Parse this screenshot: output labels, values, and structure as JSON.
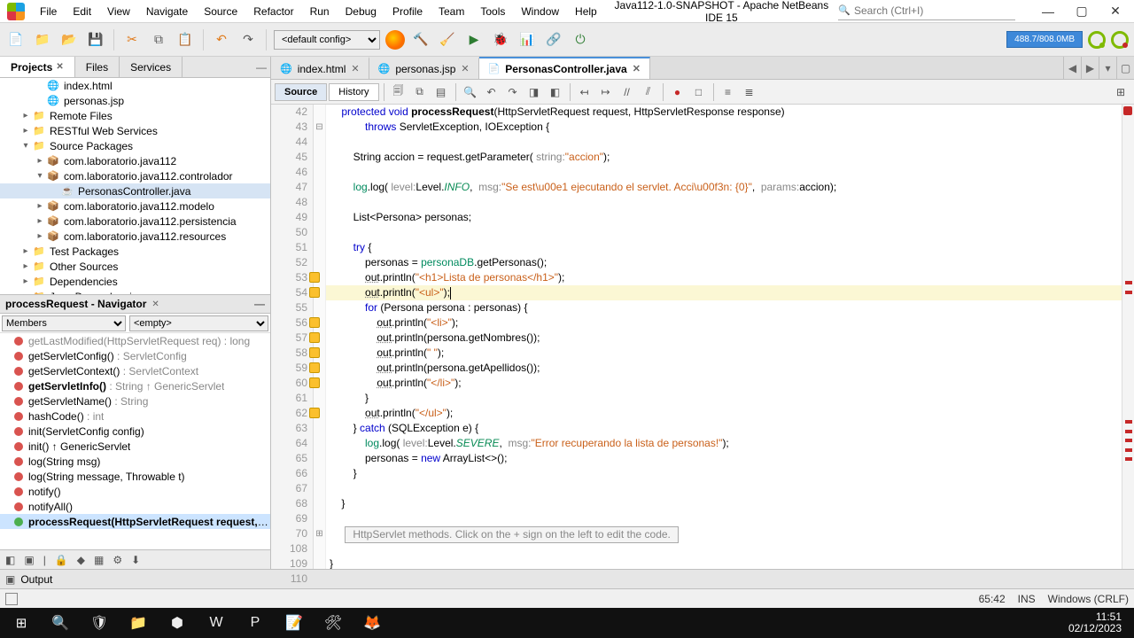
{
  "menubar": {
    "items": [
      "File",
      "Edit",
      "View",
      "Navigate",
      "Source",
      "Refactor",
      "Run",
      "Debug",
      "Profile",
      "Team",
      "Tools",
      "Window",
      "Help"
    ],
    "title": "Java112-1.0-SNAPSHOT - Apache NetBeans IDE 15",
    "search_placeholder": "Search (Ctrl+I)"
  },
  "toolbar": {
    "config": "<default config>",
    "heap": "488.7/808.0MB"
  },
  "projects": {
    "tabs": [
      "Projects",
      "Files",
      "Services"
    ],
    "tree": [
      {
        "indent": 2,
        "icon": "globe",
        "label": "index.html"
      },
      {
        "indent": 2,
        "icon": "globe",
        "label": "personas.jsp"
      },
      {
        "indent": 1,
        "twisty": ">",
        "icon": "folder",
        "label": "Remote Files"
      },
      {
        "indent": 1,
        "twisty": ">",
        "icon": "folder",
        "label": "RESTful Web Services"
      },
      {
        "indent": 1,
        "twisty": "v",
        "icon": "folder",
        "label": "Source Packages"
      },
      {
        "indent": 2,
        "twisty": ">",
        "icon": "pkg",
        "label": "com.laboratorio.java112"
      },
      {
        "indent": 2,
        "twisty": "v",
        "icon": "pkg",
        "label": "com.laboratorio.java112.controlador"
      },
      {
        "indent": 3,
        "icon": "java",
        "label": "PersonasController.java",
        "selected": true
      },
      {
        "indent": 2,
        "twisty": ">",
        "icon": "pkg",
        "label": "com.laboratorio.java112.modelo"
      },
      {
        "indent": 2,
        "twisty": ">",
        "icon": "pkg",
        "label": "com.laboratorio.java112.persistencia"
      },
      {
        "indent": 2,
        "twisty": ">",
        "icon": "pkg",
        "label": "com.laboratorio.java112.resources"
      },
      {
        "indent": 1,
        "twisty": ">",
        "icon": "folder",
        "label": "Test Packages"
      },
      {
        "indent": 1,
        "twisty": ">",
        "icon": "folder",
        "label": "Other Sources"
      },
      {
        "indent": 1,
        "twisty": ">",
        "icon": "folder",
        "label": "Dependencies"
      },
      {
        "indent": 1,
        "twisty": ">",
        "icon": "folder",
        "label": "Java Dependencies"
      }
    ]
  },
  "navigator": {
    "title": "processRequest - Navigator",
    "members_label": "Members",
    "empty_label": "<empty>",
    "items": [
      {
        "text": "getLastModified(HttpServletRequest req) : long",
        "dim": true
      },
      {
        "text": "getServletConfig() : ServletConfig"
      },
      {
        "text": "getServletContext() : ServletContext"
      },
      {
        "text": "getServletInfo() : String ↑ GenericServlet",
        "bold": true
      },
      {
        "text": "getServletName() : String"
      },
      {
        "text": "hashCode() : int"
      },
      {
        "text": "init(ServletConfig config)"
      },
      {
        "text": "init() ↑ GenericServlet"
      },
      {
        "text": "log(String msg)"
      },
      {
        "text": "log(String message, Throwable t)"
      },
      {
        "text": "notify()"
      },
      {
        "text": "notifyAll()"
      },
      {
        "text": "processRequest(HttpServletRequest request, HttpS",
        "selected": true,
        "bold": true
      }
    ]
  },
  "editor": {
    "tabs": [
      {
        "label": "index.html",
        "icon": "🌐"
      },
      {
        "label": "personas.jsp",
        "icon": "🌐"
      },
      {
        "label": "PersonasController.java",
        "icon": "📄",
        "active": true
      }
    ],
    "views": {
      "source": "Source",
      "history": "History"
    },
    "line_numbers": [
      42,
      43,
      44,
      45,
      46,
      47,
      48,
      49,
      50,
      51,
      52,
      53,
      54,
      55,
      56,
      57,
      58,
      59,
      60,
      61,
      62,
      63,
      64,
      65,
      66,
      67,
      68,
      69,
      70,
      108,
      109,
      110
    ],
    "err_lines": [
      53,
      54,
      56,
      57,
      58,
      59,
      60,
      62
    ],
    "fold_text": "HttpServlet methods. Click on the + sign on the left to edit the code."
  },
  "output": {
    "label": "Output"
  },
  "status": {
    "pos": "65:42",
    "ins": "INS",
    "os": "Windows (CRLF)"
  },
  "taskbar": {
    "time": "11:51",
    "date": "02/12/2023"
  }
}
